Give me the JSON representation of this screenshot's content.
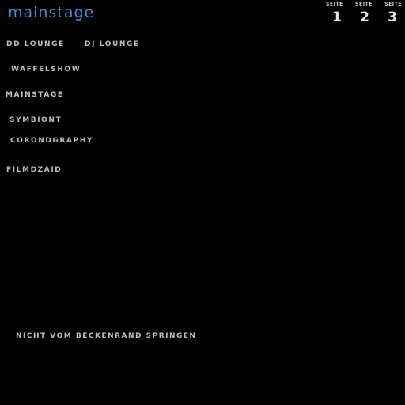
{
  "header": {
    "logo_text": "mainstage"
  },
  "page_switcher": {
    "label": "SEITE",
    "pages": [
      "1",
      "2",
      "3"
    ]
  },
  "nav": {
    "dd_lounge": "DD LOUNGE",
    "dj_lounge": "DJ LOUNGE",
    "waffelshow": "WAFFELSHOW",
    "mainstage": "MAINSTAGE",
    "symbiont": "SYMBIONT",
    "corondgraphy": "CORONDGRAPHY",
    "filmdzaid": "FILMDZAID"
  },
  "footer": {
    "note": "NICHT VOM BECKENRAND SPRINGEN"
  },
  "colors": {
    "background": "#000000",
    "logo": "#3b8fd6",
    "text": "#bcbcbc"
  }
}
